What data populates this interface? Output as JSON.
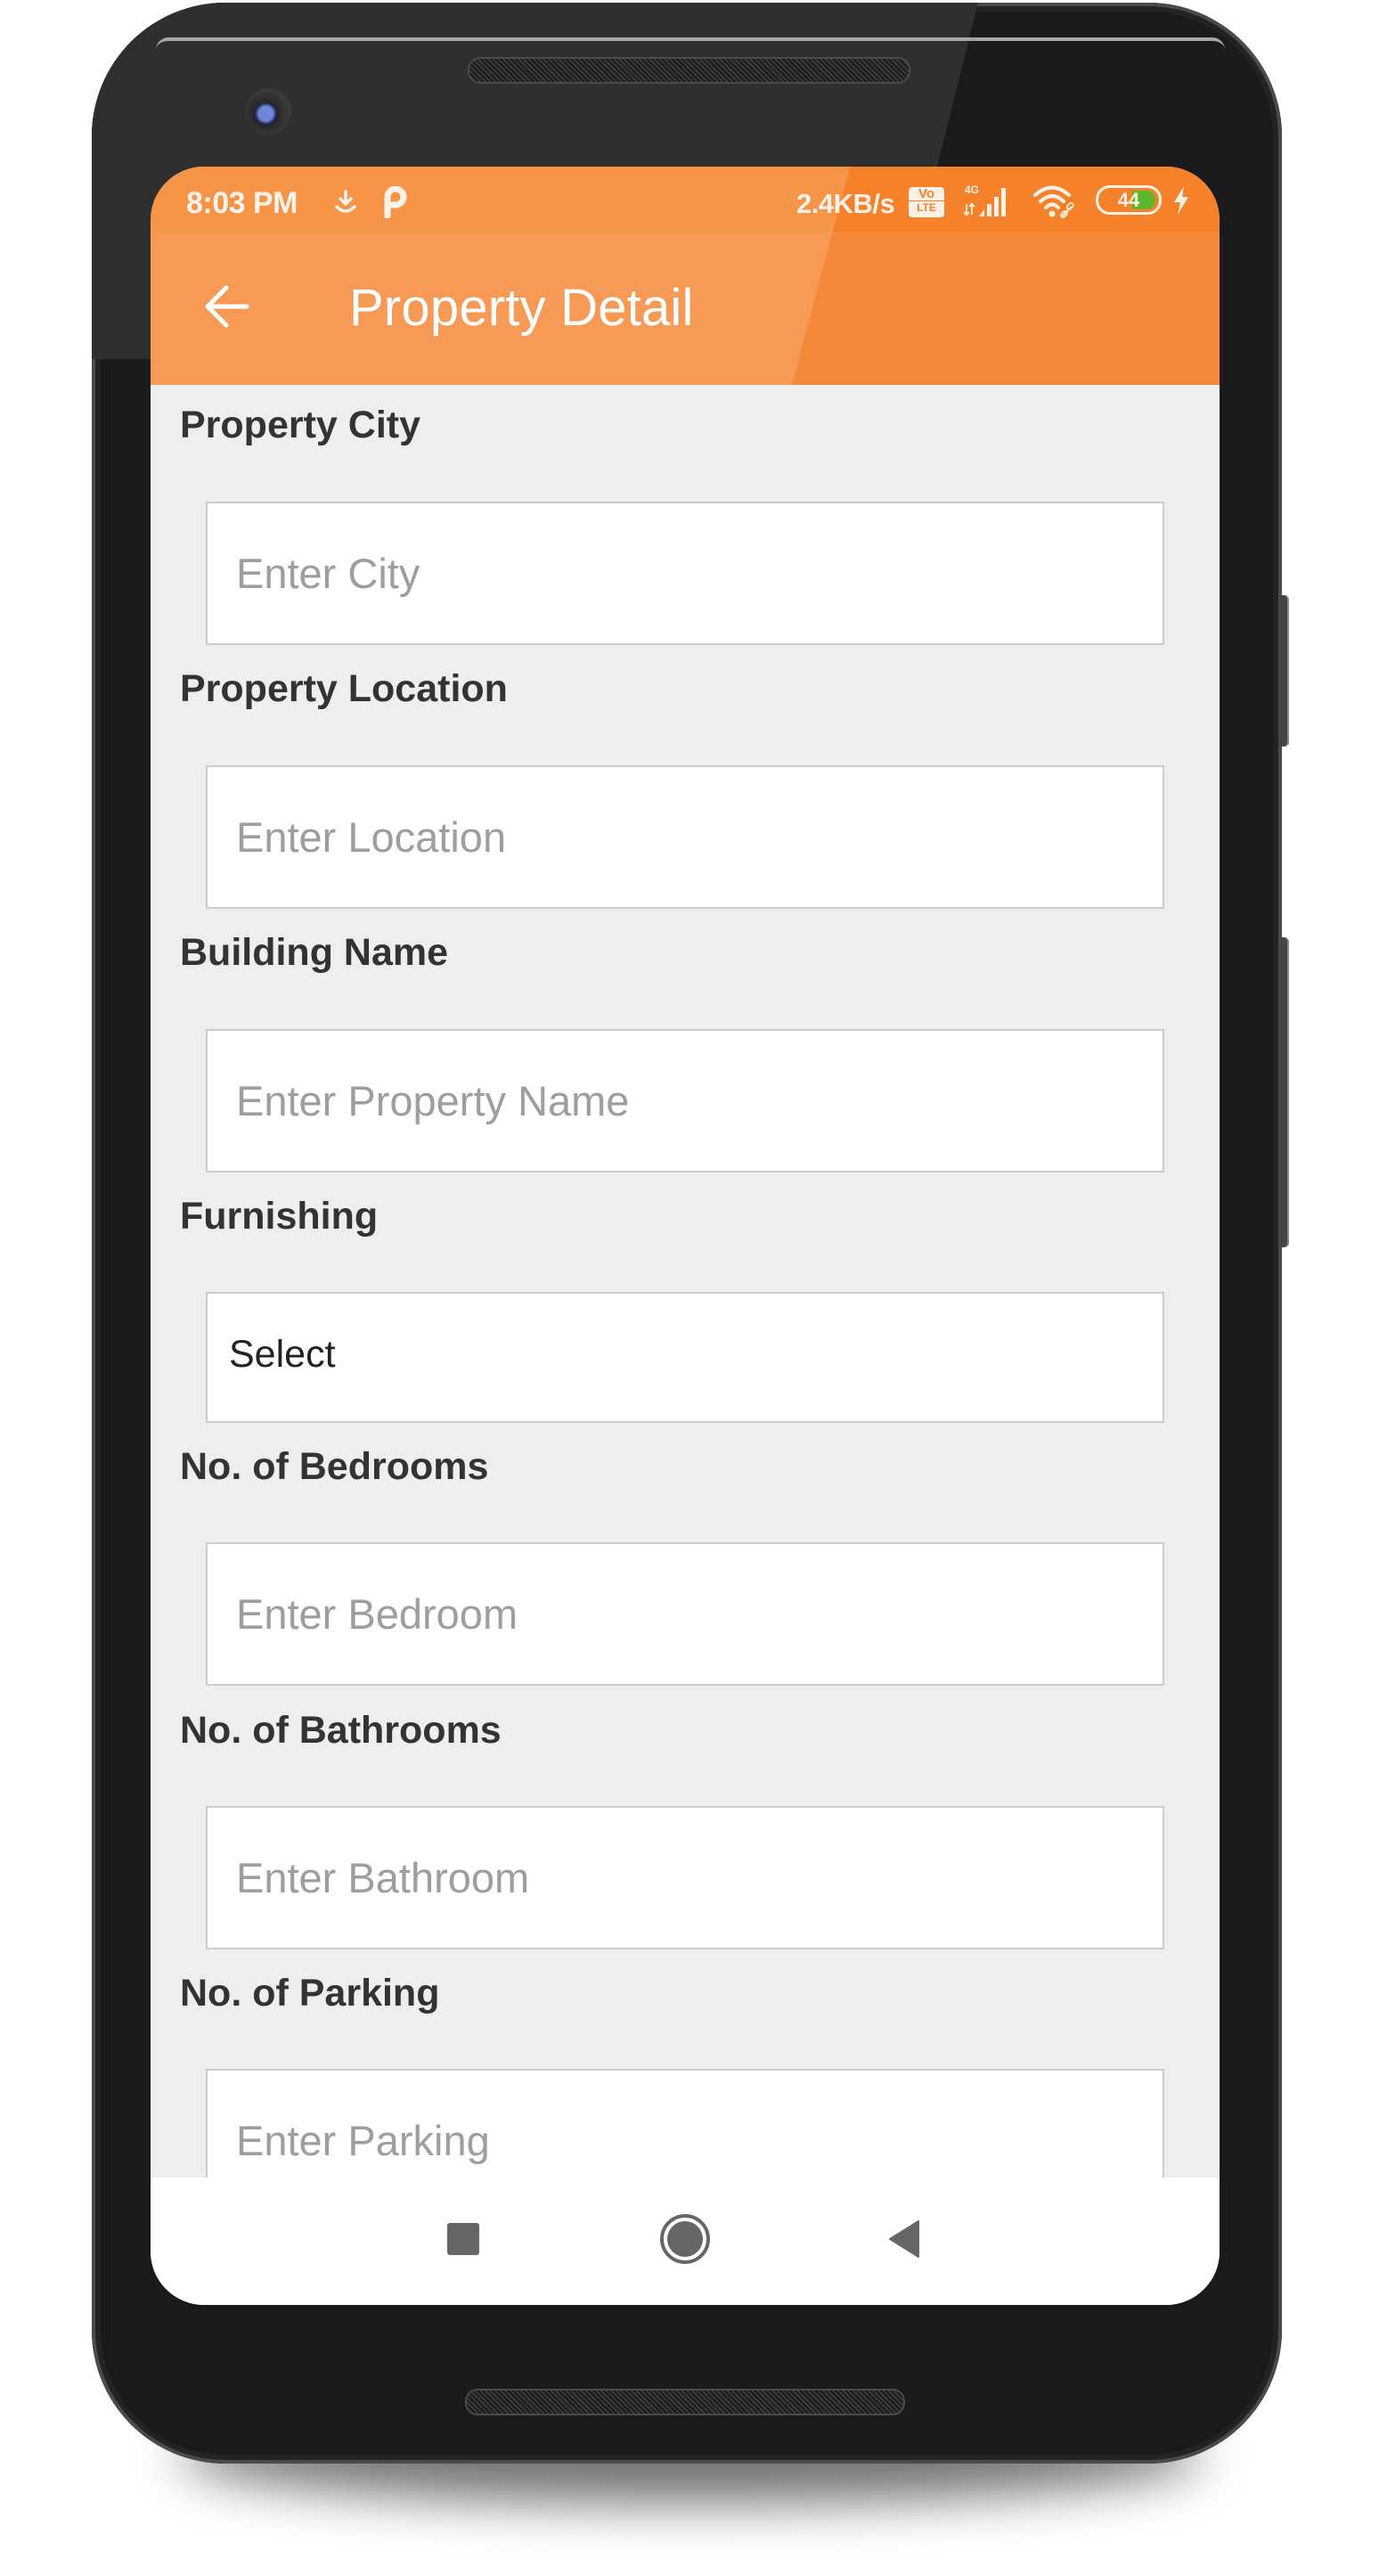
{
  "status_bar": {
    "time": "8:03 PM",
    "left_icons": [
      "download-icon",
      "parking-app-icon"
    ],
    "network_speed": "2.4KB/s",
    "volte_top": "Vo",
    "volte_bottom": "LTE",
    "network_type": "4G",
    "right_icons": [
      "volte-icon",
      "signal-icon",
      "wifi-icon",
      "battery-icon",
      "charging-icon"
    ],
    "battery_percent": 44,
    "battery_label": "44"
  },
  "app_bar": {
    "back_icon": "arrow-left-icon",
    "title": "Property Detail",
    "color": "#F5893A"
  },
  "form": {
    "fields": [
      {
        "label": "Property City",
        "type": "text",
        "placeholder": "Enter City",
        "value": ""
      },
      {
        "label": "Property Location",
        "type": "text",
        "placeholder": "Enter Location",
        "value": ""
      },
      {
        "label": "Building Name",
        "type": "text",
        "placeholder": "Enter Property Name",
        "value": ""
      },
      {
        "label": "Furnishing",
        "type": "select",
        "selected": "Select"
      },
      {
        "label": "No. of Bedrooms",
        "type": "text",
        "placeholder": "Enter Bedroom",
        "value": ""
      },
      {
        "label": "No. of Bathrooms",
        "type": "text",
        "placeholder": "Enter Bathroom",
        "value": ""
      },
      {
        "label": "No. of Parking",
        "type": "text",
        "placeholder": "Enter Parking",
        "value": ""
      }
    ]
  },
  "nav_bar": {
    "buttons": [
      "recents-square-icon",
      "home-circle-icon",
      "back-triangle-icon"
    ]
  },
  "colors": {
    "accent": "#F5822A",
    "background": "#EEEEEE",
    "label": "#333333",
    "placeholder": "#9E9E9E",
    "battery_fill": "#5CB82A"
  }
}
